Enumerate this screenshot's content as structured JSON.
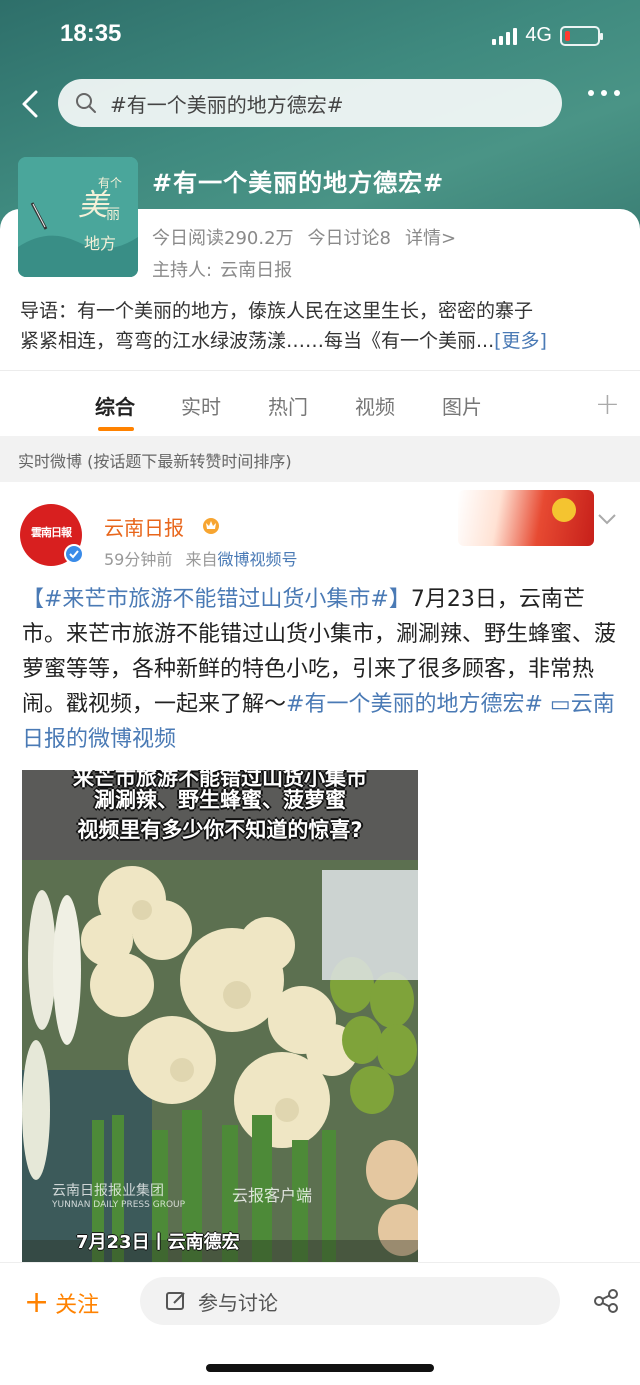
{
  "status_bar": {
    "time": "18:35",
    "network": "4G"
  },
  "search": {
    "query": "#有一个美丽的地方德宏#"
  },
  "topic": {
    "title": "#有一个美丽的地方德宏#",
    "reads": "今日阅读290.2万",
    "discussions": "今日讨论8",
    "details": "详情>",
    "host_label": "主持人:",
    "host_name": "云南日报",
    "intro_line1": "导语：有一个美丽的地方，傣族人民在这里生长，密密的寨子",
    "intro_line2": "紧紧相连，弯弯的江水绿波荡漾……每当《有一个美丽...",
    "intro_more": "[更多]"
  },
  "tabs": [
    "综合",
    "实时",
    "热门",
    "视频",
    "图片"
  ],
  "active_tab": "综合",
  "section": {
    "label": "实时微博 (按话题下最新转赞时间排序)"
  },
  "post": {
    "avatar_text": "雲南日報",
    "author": "云南日报",
    "time": "59分钟前",
    "source_prefix": "来自",
    "source": "微博视频号",
    "text_link1": "【#来芒市旅游不能错过山货小集市#】",
    "text_body": "7月23日，云南芒市。来芒市旅游不能错过山货小集市，涮涮辣、野生蜂蜜、菠萝蜜等等，各种新鲜的特色小吃，引来了很多顾客，非常热闹。戳视频，一起来了解～",
    "text_link2": "#有一个美丽的地方德宏#",
    "text_link3": "云南日报的微博视频",
    "video": {
      "caption_top": "来芒市旅游不能错过山货小集市",
      "caption_line2": "涮涮辣、野生蜂蜜、菠萝蜜",
      "caption_line3": "视频里有多少你不知道的惊喜?",
      "watermark_group": "云南日报报业集团",
      "watermark_group_en": "YUNNAN DAILY PRESS GROUP",
      "watermark_app": "云报客户端",
      "date_caption": "7月23日丨云南德宏"
    }
  },
  "bottom_bar": {
    "follow": "关注",
    "discuss": "参与讨论"
  },
  "colors": {
    "accent": "#ff8200",
    "link": "#4a7ab5",
    "header": "#3f8a7f"
  }
}
